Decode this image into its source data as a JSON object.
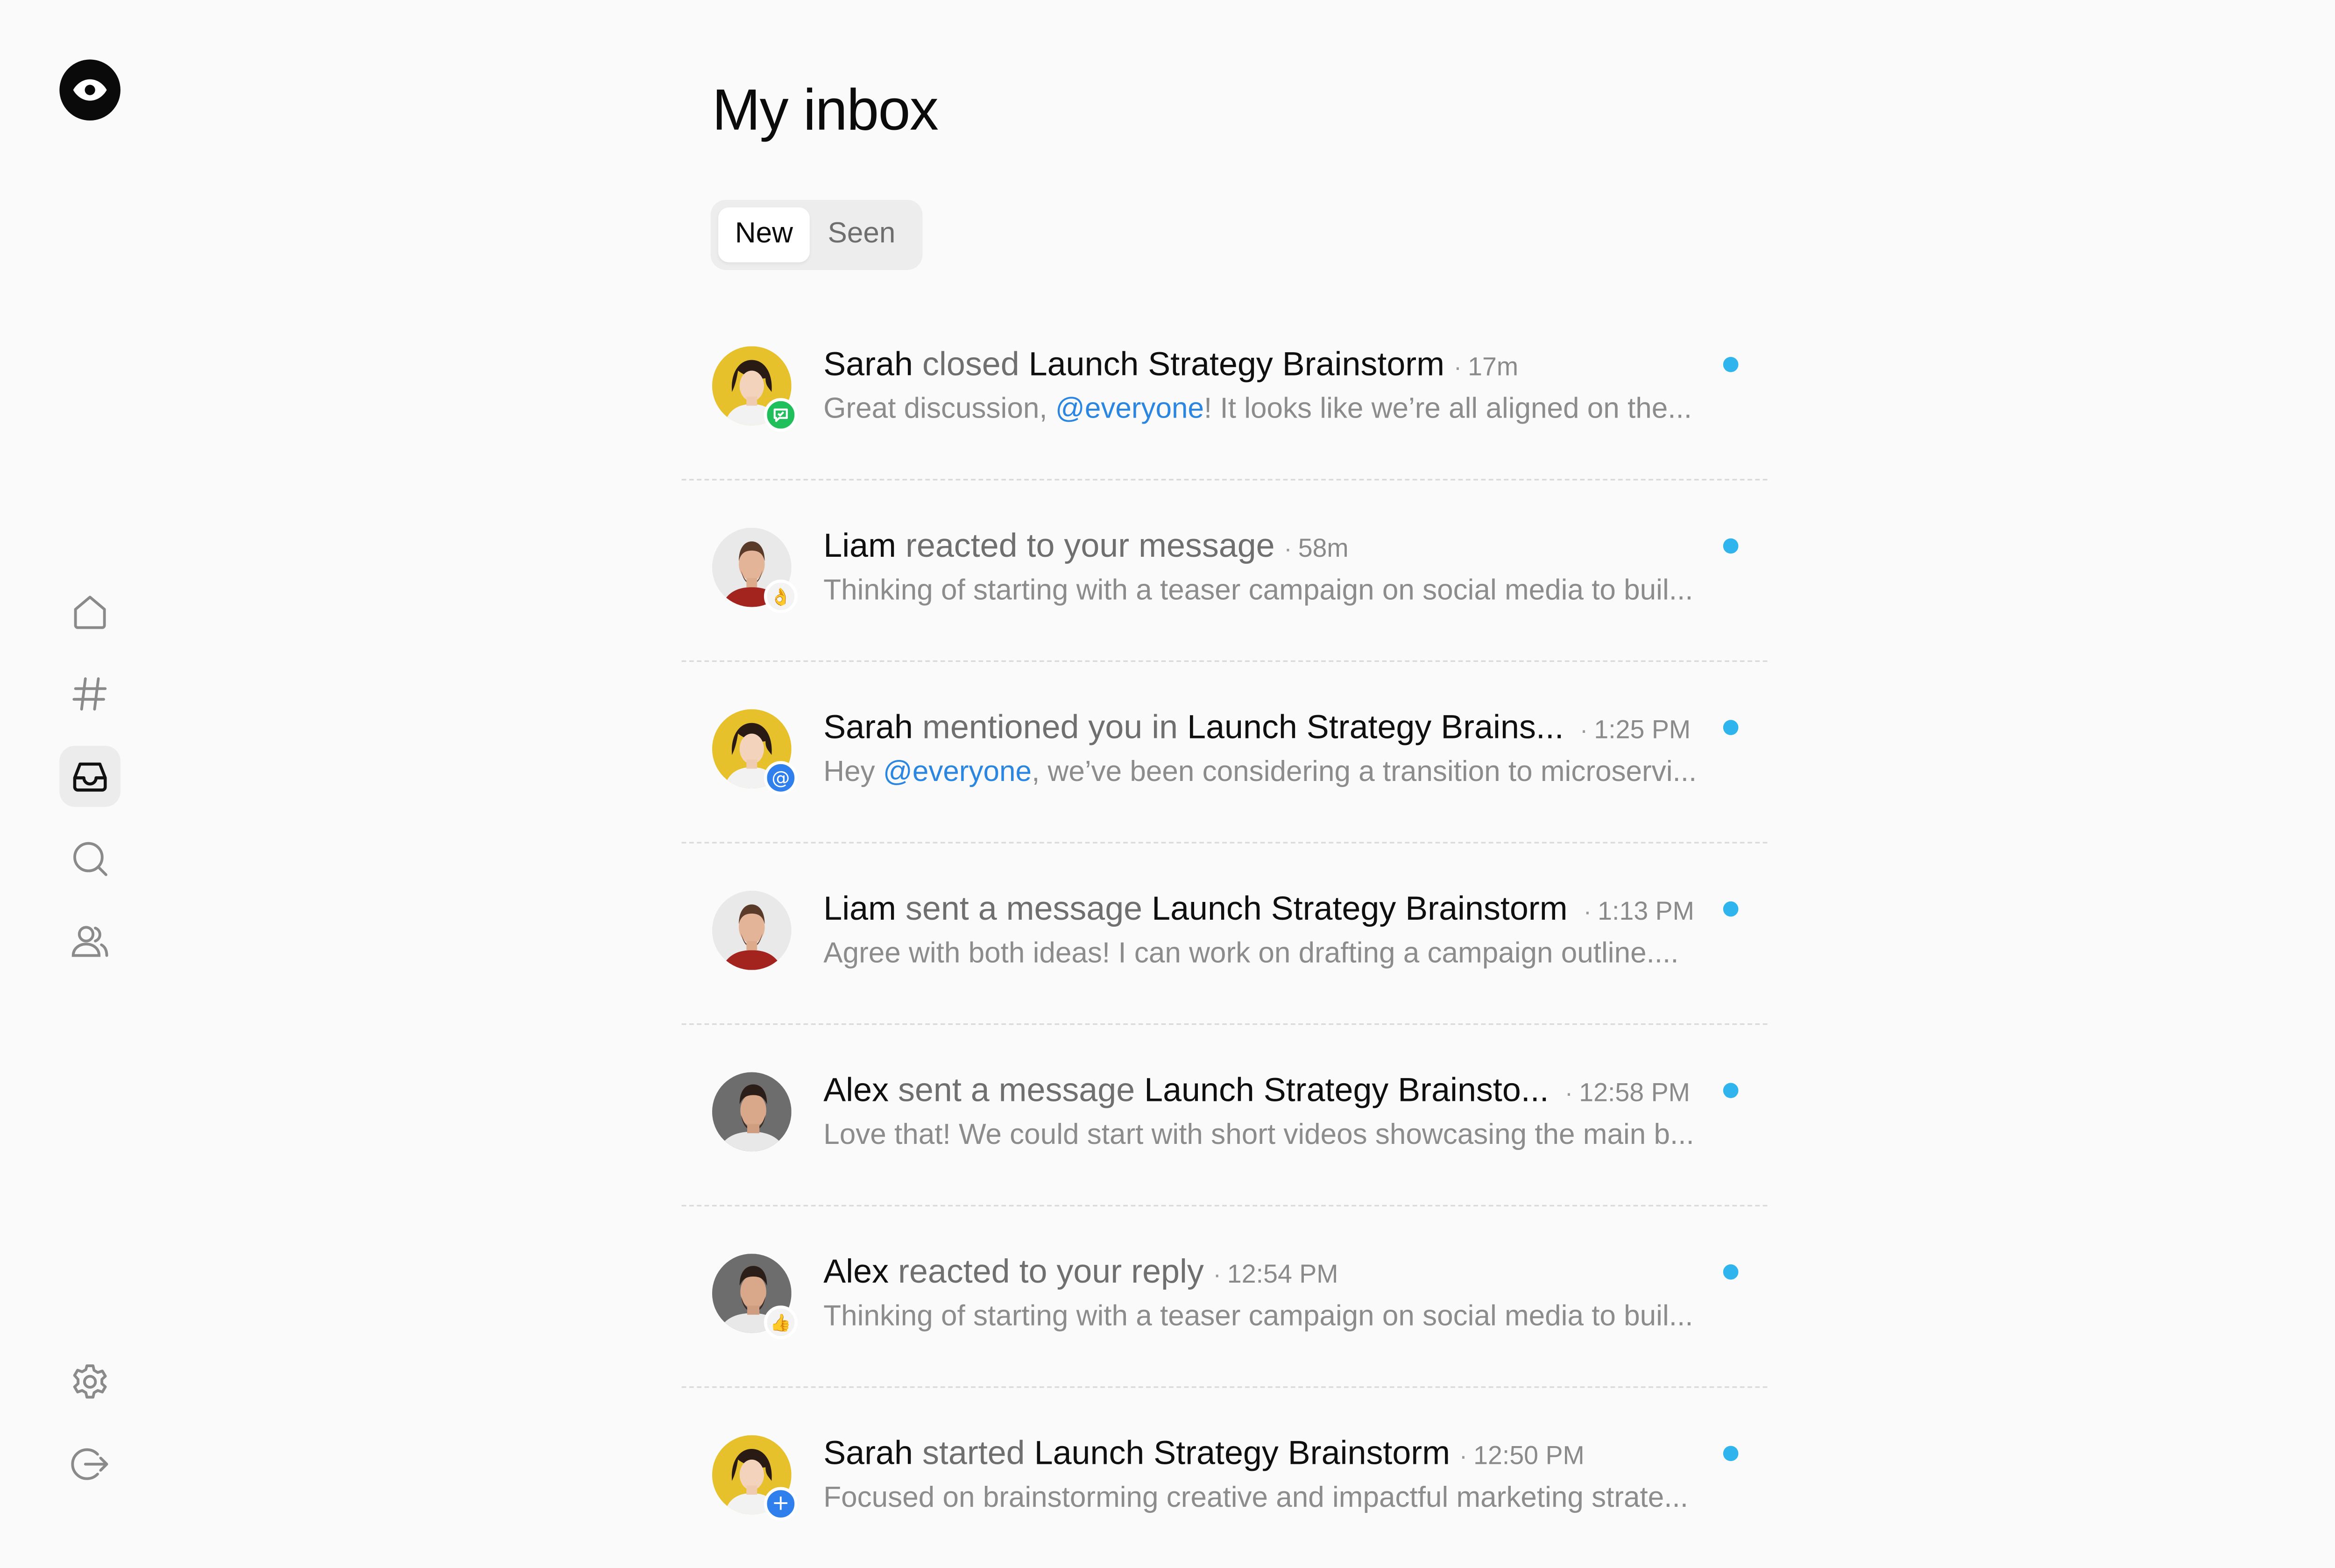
{
  "app": {
    "logo_icon": "eye-icon"
  },
  "sidebar": {
    "items": [
      {
        "icon": "home-icon"
      },
      {
        "icon": "hash-icon"
      },
      {
        "icon": "inbox-icon",
        "active": true
      },
      {
        "icon": "search-icon"
      },
      {
        "icon": "users-icon"
      }
    ],
    "bottom": [
      {
        "icon": "gear-icon"
      },
      {
        "icon": "logout-icon"
      }
    ]
  },
  "page": {
    "title": "My inbox"
  },
  "tabs": {
    "new": "New",
    "seen": "Seen",
    "selected": "New"
  },
  "colors": {
    "unread": "#2fb4ee",
    "mention": "#2a86e0",
    "badge_green": "#1fbf5b",
    "badge_blue": "#2f80ed"
  },
  "notifications": [
    {
      "actor": "Sarah",
      "verb": "closed",
      "target": "Launch Strategy Brainstorm",
      "time": "17m",
      "preview_before": "Great discussion, ",
      "mention": "@everyone",
      "preview_after": "! It looks like we’re all aligned on the...",
      "badge": "chat-check-icon",
      "unread": true
    },
    {
      "actor": "Liam",
      "verb": "reacted to your message",
      "target": "",
      "time": "58m",
      "preview_before": "Thinking of starting with a teaser campaign on social media to buil...",
      "mention": "",
      "preview_after": "",
      "badge": "👌",
      "unread": true
    },
    {
      "actor": "Sarah",
      "verb": "mentioned you in",
      "target": "Launch Strategy Brains...",
      "time": "1:25 PM",
      "preview_before": "Hey ",
      "mention": "@everyone",
      "preview_after": ", we’ve been considering a transition to microservi...",
      "badge": "@",
      "unread": true
    },
    {
      "actor": "Liam",
      "verb": "sent a message",
      "target": "Launch Strategy Brainstorm",
      "time": "1:13 PM",
      "preview_before": "Agree with both ideas! I can work on drafting a campaign outline....",
      "mention": "",
      "preview_after": "",
      "badge": "",
      "unread": true
    },
    {
      "actor": "Alex",
      "verb": "sent a message",
      "target": "Launch Strategy Brainsto...",
      "time": "12:58 PM",
      "preview_before": "Love that! We could start with short videos showcasing the main b...",
      "mention": "",
      "preview_after": "",
      "badge": "",
      "unread": true
    },
    {
      "actor": "Alex",
      "verb": "reacted to your reply",
      "target": "",
      "time": "12:54 PM",
      "preview_before": "Thinking of starting with a teaser campaign on social media to buil...",
      "mention": "",
      "preview_after": "",
      "badge": "👍",
      "unread": true
    },
    {
      "actor": "Sarah",
      "verb": "started",
      "target": "Launch Strategy Brainstorm",
      "time": "12:50 PM",
      "preview_before": "Focused on brainstorming creative and impactful marketing strate...",
      "mention": "",
      "preview_after": "",
      "badge": "+",
      "unread": true
    }
  ]
}
